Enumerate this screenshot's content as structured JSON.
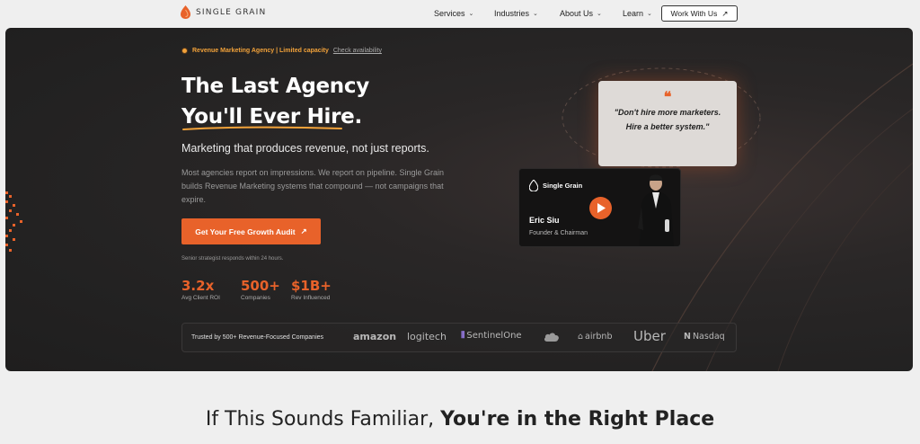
{
  "nav": {
    "logo_text": "SINGLE GRAIN",
    "items": [
      {
        "label": "Services"
      },
      {
        "label": "Industries"
      },
      {
        "label": "About Us"
      },
      {
        "label": "Learn"
      }
    ],
    "cta_label": "Work With Us"
  },
  "hero": {
    "badge_text": "Revenue Marketing Agency | Limited capacity",
    "badge_link": "Check availability",
    "title_line1": "The Last Agency",
    "title_line2": "You'll Ever Hire.",
    "subtitle": "Marketing that produces revenue, not just reports.",
    "paragraph": "Most agencies report on impressions. We report on pipeline. Single Grain builds Revenue Marketing systems that compound — not campaigns that expire.",
    "cta_label": "Get Your Free Growth Audit",
    "cta_note": "Senior strategist responds within 24 hours.",
    "stats": [
      {
        "value": "3.2x",
        "label": "Avg Client ROI"
      },
      {
        "value": "500+",
        "label": "Companies"
      },
      {
        "value": "$1B+",
        "label": "Rev Influenced"
      }
    ],
    "trust_label": "Trusted by 500+ Revenue-Focused Companies",
    "brands": [
      "amazon",
      "logitech",
      "SentinelOne",
      "salesforce",
      "airbnb",
      "Uber",
      "Nasdaq"
    ],
    "quote_mark": "❝",
    "quote": "\"Don't hire more marketers. Hire a better system.\"",
    "video": {
      "brand": "Single Grain",
      "name": "Eric Siu",
      "role": "Founder & Chairman"
    }
  },
  "section": {
    "heading_light": "If This Sounds Familiar, ",
    "heading_bold": "You're in the Right Place"
  },
  "colors": {
    "accent": "#e8622a",
    "badge": "#f2a23a",
    "hero_bg": "#232222"
  }
}
